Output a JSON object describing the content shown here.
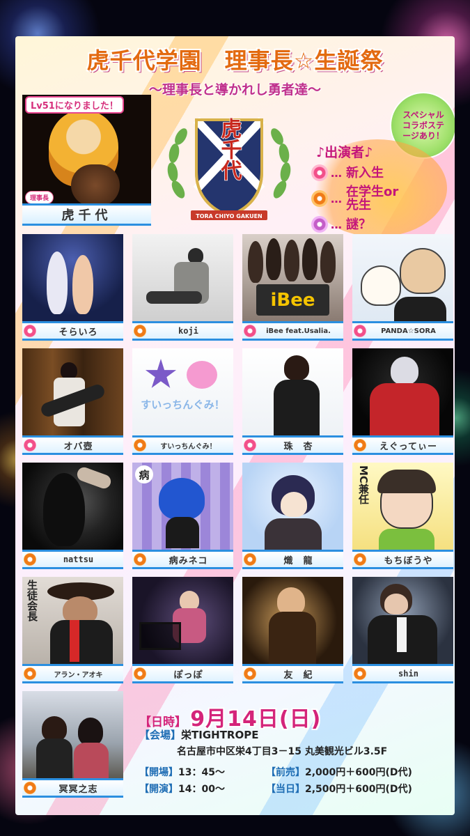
{
  "event": {
    "title": "虎千代学園　理事長☆生誕祭",
    "subtitle": "〜理事長と導かれし勇者達〜"
  },
  "hero": {
    "caption": "Lv51になりました！",
    "badge": "理事長",
    "name": "虎千代"
  },
  "emblem": {
    "text": "虎千代",
    "ribbon": "TORA CHIYO GAKUEN"
  },
  "special_badge": "スペシャルコラボステージあり！",
  "cast_legend": {
    "title": "♪出演者♪",
    "items": [
      {
        "icon": "pink-flower-icon",
        "dots": "…",
        "label": "新入生"
      },
      {
        "icon": "orange-flower-icon",
        "dots": "…",
        "label": "在学生or先生"
      },
      {
        "icon": "purple-flower-icon",
        "dots": "…",
        "label": "謎？"
      }
    ]
  },
  "performers": [
    {
      "name": "そらいろ",
      "icon": "pink-flower-icon"
    },
    {
      "name": "koji",
      "icon": "orange-flower-icon"
    },
    {
      "name": "iBee feat.Usalia.",
      "icon": "pink-flower-icon",
      "photo_text": "iBee"
    },
    {
      "name": "PANDA☆SORA",
      "icon": "pink-flower-icon"
    },
    {
      "name": "オバ壺",
      "icon": "pink-flower-icon"
    },
    {
      "name": "すいっちんぐみ！",
      "icon": "orange-flower-icon",
      "photo_text": "すいっちんぐみ！"
    },
    {
      "name": "珠　杏",
      "icon": "pink-flower-icon"
    },
    {
      "name": "えぐってぃー",
      "icon": "orange-flower-icon"
    },
    {
      "name": "nattsu",
      "icon": "orange-flower-icon"
    },
    {
      "name": "病みネコ",
      "icon": "orange-flower-icon",
      "photo_text": "病"
    },
    {
      "name": "熾　龍",
      "icon": "orange-flower-icon"
    },
    {
      "name": "もちぼうや",
      "icon": "orange-flower-icon",
      "photo_text": "MC兼任"
    },
    {
      "name": "アラン・アオキ",
      "icon": "orange-flower-icon",
      "photo_text": "生徒会長"
    },
    {
      "name": "ぽっぽ",
      "icon": "orange-flower-icon"
    },
    {
      "name": "友　紀",
      "icon": "orange-flower-icon"
    },
    {
      "name": "shin",
      "icon": "orange-flower-icon"
    },
    {
      "name": "冥冥之志",
      "icon": "orange-flower-icon"
    }
  ],
  "info": {
    "date_label": "【日時】",
    "date_value": "9月14日(日)",
    "venue_label": "【会場】",
    "venue_name": "栄TIGHTROPE",
    "address": "名古屋市中区栄4丁目3－15 丸美観光ビル3.5F",
    "open_label": "【開場】",
    "open_time": "13：45〜",
    "start_label": "【開演】",
    "start_time": "14：00〜",
    "advance_label": "【前売】",
    "advance_price": "2,000円＋600円(D代)",
    "door_label": "【当日】",
    "door_price": "2,500円＋600円(D代)"
  }
}
